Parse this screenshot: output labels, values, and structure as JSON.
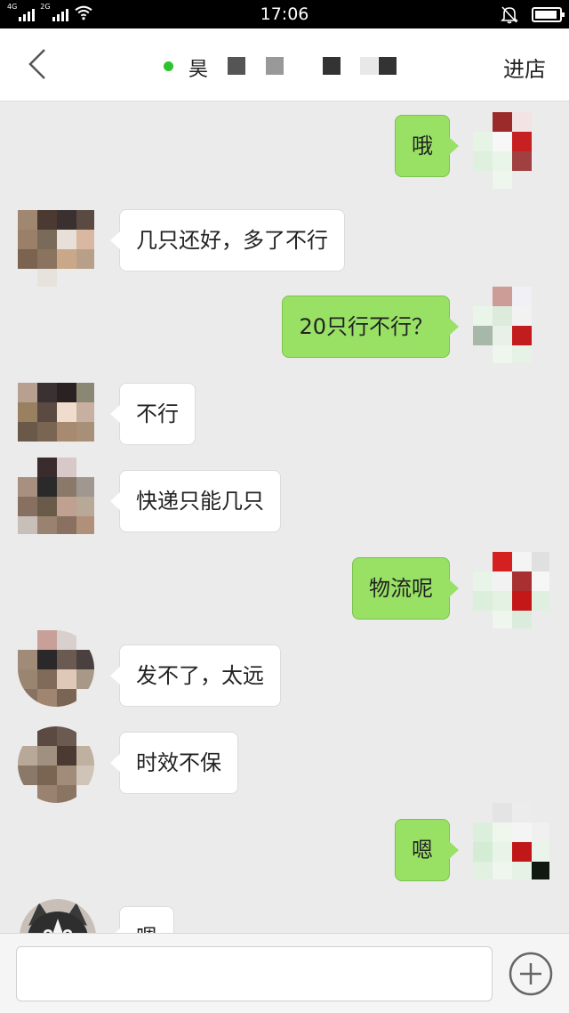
{
  "status_bar": {
    "time": "17:06",
    "network1": "4G",
    "network2": "2G"
  },
  "header": {
    "title": "昊",
    "enter_shop_label": "进店",
    "online_color": "#2dc42d"
  },
  "messages": [
    {
      "side": "right",
      "text": "哦"
    },
    {
      "side": "left",
      "text": "几只还好，多了不行"
    },
    {
      "side": "right",
      "text": "20只行不行？"
    },
    {
      "side": "left",
      "text": "不行"
    },
    {
      "side": "left",
      "text": "快递只能几只"
    },
    {
      "side": "right",
      "text": "物流呢"
    },
    {
      "side": "left",
      "text": "发不了，太远"
    },
    {
      "side": "left",
      "text": "时效不保"
    },
    {
      "side": "right",
      "text": "嗯"
    },
    {
      "side": "left",
      "text": "嗯"
    }
  ],
  "input": {
    "value": "",
    "placeholder": ""
  },
  "colors": {
    "chat_background": "#ebebeb",
    "sent_bubble": "#98e165",
    "received_bubble": "#ffffff"
  }
}
